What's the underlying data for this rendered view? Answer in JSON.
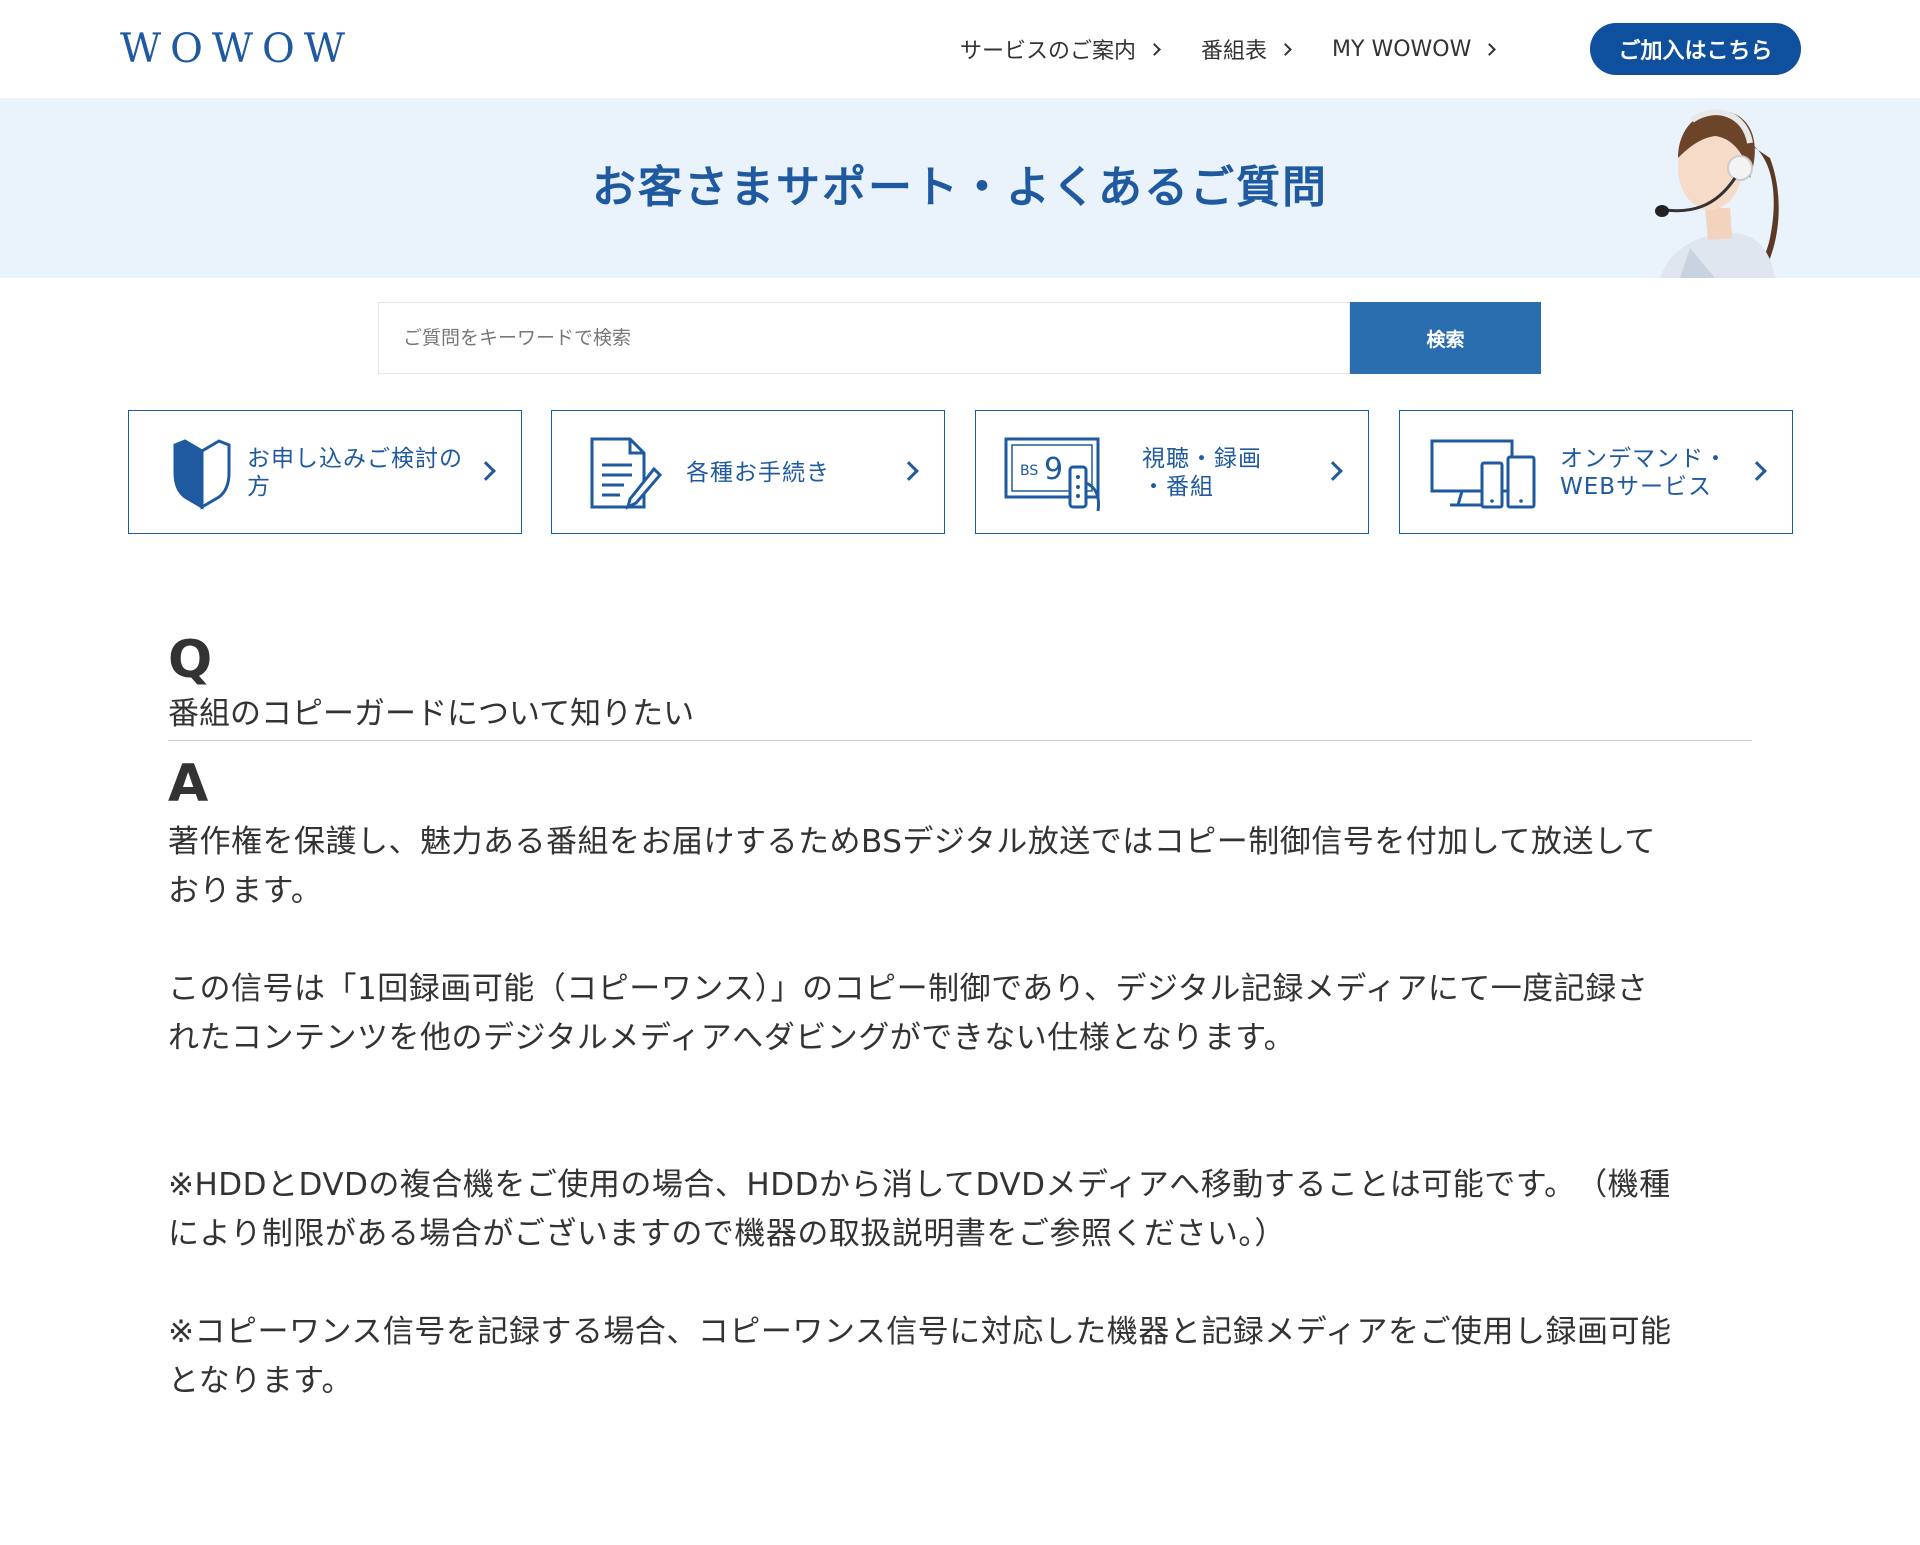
{
  "header": {
    "logo": "WOWOW",
    "nav": [
      {
        "label": "サービスのご案内"
      },
      {
        "label": "番組表"
      },
      {
        "label": "MY WOWOW"
      }
    ],
    "join_label": "ご加入はこちら"
  },
  "hero": {
    "title": "お客さまサポート・よくあるご質問"
  },
  "search": {
    "placeholder": "ご質問をキーワードで検索",
    "button_label": "検索"
  },
  "categories": [
    {
      "label_line1": "お申し込みご検討の",
      "label_line2": "方",
      "icon": "beginner-mark-icon"
    },
    {
      "label_line1": "各種お手続き",
      "label_line2": "",
      "icon": "document-pen-icon"
    },
    {
      "label_line1": "視聴・録画",
      "label_line2": "・番組",
      "icon": "tv-remote-icon"
    },
    {
      "label_line1": "オンデマンド・",
      "label_line2": "WEBサービス",
      "icon": "devices-icon"
    }
  ],
  "faq": {
    "q_label": "Q",
    "question": "番組のコピーガードについて知りたい",
    "a_label": "A",
    "answer": {
      "p1a": "著作権を保護し、魅力ある番組をお届けするためBSデジタル放送ではコピー制御信号を付加して放送して",
      "p1b": "おります。",
      "p2a": "この信号は「1回録画可能（コピーワンス）」のコピー制御であり、デジタル記録メディアにて一度記録さ",
      "p2b": "れたコンテンツを他のデジタルメディアへダビングができない仕様となります。",
      "p3a": "※HDDとDVDの複合機をご使用の場合、HDDから消してDVDメディアへ移動することは可能です。　（機種",
      "p3b": "により制限がある場合がございますので機器の取扱説明書をご参照ください。）",
      "p4a": "※コピーワンス信号を記録する場合、コピーワンス信号に対応した機器と記録メディアをご使用し録画可能",
      "p4b": "となります。"
    }
  },
  "colors": {
    "brand": "#1f5aa0",
    "join_button": "#0e4f9e",
    "search_button": "#2b6eb0",
    "hero_bg": "#eaf2fb"
  }
}
